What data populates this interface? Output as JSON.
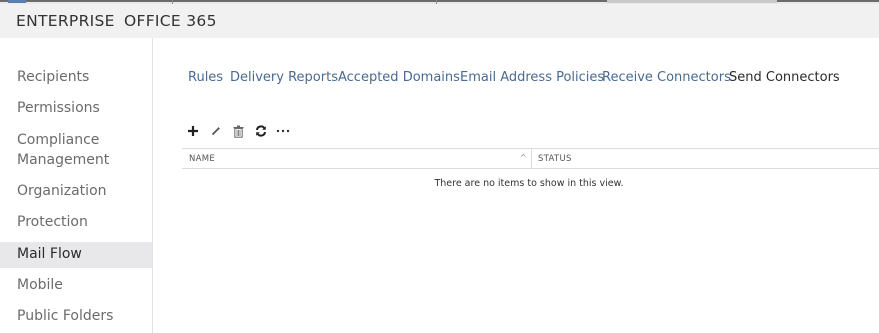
{
  "header": {
    "brand": "ENTERPRISE",
    "product": "OFFICE 365"
  },
  "sidebar": {
    "items": [
      {
        "label": "Recipients"
      },
      {
        "label": "Permissions"
      },
      {
        "label": "Compliance"
      },
      {
        "label": "Management"
      },
      {
        "label": "Organization"
      },
      {
        "label": "Protection"
      },
      {
        "label": "Mail Flow",
        "selected": true
      },
      {
        "label": "Mobile"
      },
      {
        "label": "Public Folders"
      }
    ]
  },
  "tabs": [
    {
      "label": "Rules"
    },
    {
      "label": "Delivery Reports"
    },
    {
      "label": "Accepted Domains"
    },
    {
      "label": "Email Address Policies"
    },
    {
      "label": "Receive Connectors"
    },
    {
      "label": "Send Connectors",
      "active": true
    }
  ],
  "toolbar": {
    "icons": [
      "plus-icon",
      "pencil-icon",
      "trash-icon",
      "refresh-icon",
      "more-icon"
    ]
  },
  "grid": {
    "columns": [
      "NAME",
      "STATUS"
    ],
    "empty_message": "There are no items to show in this view."
  },
  "colors": {
    "accent": "#4a6a8f",
    "selected_bg": "#e8e8ea",
    "header_bg": "#f1f1f1"
  }
}
